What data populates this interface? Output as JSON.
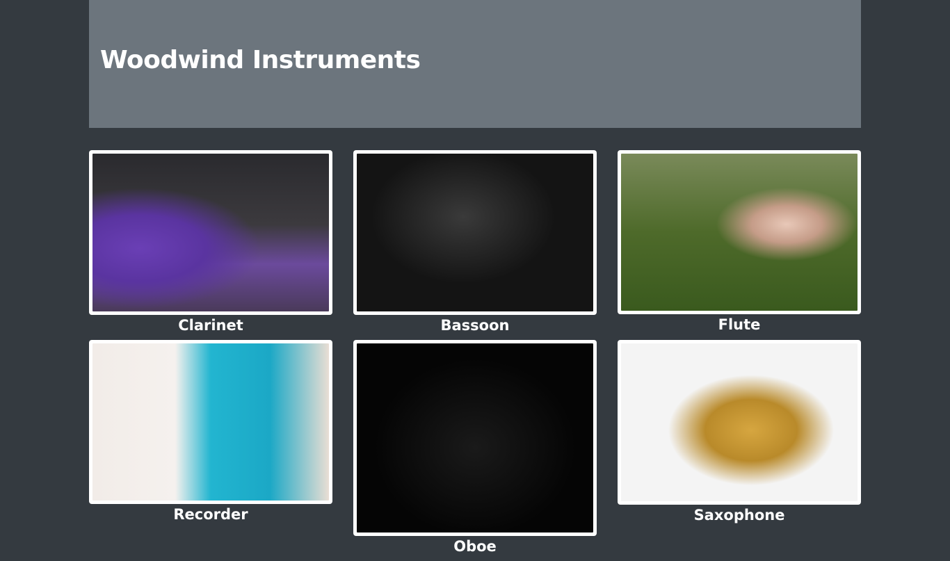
{
  "header": {
    "title": "Woodwind Instruments"
  },
  "instruments": [
    {
      "name": "Clarinet"
    },
    {
      "name": "Bassoon"
    },
    {
      "name": "Flute"
    },
    {
      "name": "Recorder"
    },
    {
      "name": "Oboe"
    },
    {
      "name": "Saxophone"
    }
  ]
}
